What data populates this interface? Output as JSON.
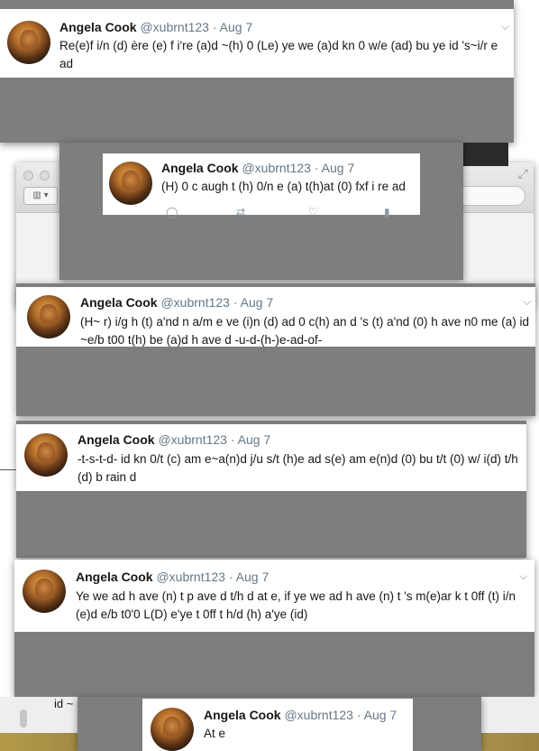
{
  "tweets": [
    {
      "name": "Angela Cook",
      "handle": "@xubrnt123",
      "sep": "·",
      "date": "Aug 7",
      "text": "Re(e)f i/n (d) ère (e) f i're (a)d ~(h) 0 (Le) ye we (a)d kn 0 w/e (ad) bu ye id 's~i/r e ad"
    },
    {
      "name": "Angela Cook",
      "handle": "@xubrnt123",
      "sep": "·",
      "date": "Aug 7",
      "text": "(H) 0 c augh t (h) 0/n e (a) t(h)at (0) fxf i re ad"
    },
    {
      "name": "Angela Cook",
      "handle": "@xubrnt123",
      "sep": "·",
      "date": "Aug 7",
      "text": "(H~ r) i/g h (t) a'nd n a/m e ve (i)n (d) ad 0 c(h) an d 's (t) a'nd (0) h ave n0 me (a) id ~e/b t00 t(h) be (a)d h ave d -u-d-(h-)e-ad-of-"
    },
    {
      "name": "Angela Cook",
      "handle": "@xubrnt123",
      "sep": "·",
      "date": "Aug 7",
      "text": "-t-s-t-d- id kn 0/t (c) am e~a(n)d j/u s/t (h)e ad s(e) am e(n)d (0) bu t/t (0) w/ i(d) t/h (d) b rain d"
    },
    {
      "name": "Angela Cook",
      "handle": "@xubrnt123",
      "sep": "·",
      "date": "Aug 7",
      "text": "Ye we ad h ave (n) t p ave d t/h d at e, if ye we ad h ave (n) t 's m(e)ar k t 0ff (t) i/n (e)d e/b t0'0 L(D) e'ye t 0ff t h/d (h) a'ye (id)"
    },
    {
      "name": "Angela Cook",
      "handle": "@xubrnt123",
      "sep": "·",
      "date": "Aug 7",
      "text": "At e"
    }
  ],
  "partial": {
    "left_text": "id ~"
  },
  "icons": {
    "chevron": "chevron-down-icon",
    "reply": "reply-icon",
    "retweet": "retweet-icon",
    "like": "heart-icon",
    "stats": "stats-icon",
    "expand": "expand-icon",
    "sidebar": "sidebar-toggle-icon"
  },
  "colors": {
    "overlay_gray": "#7e7e7e",
    "name": "#14171a",
    "meta": "#657786"
  }
}
